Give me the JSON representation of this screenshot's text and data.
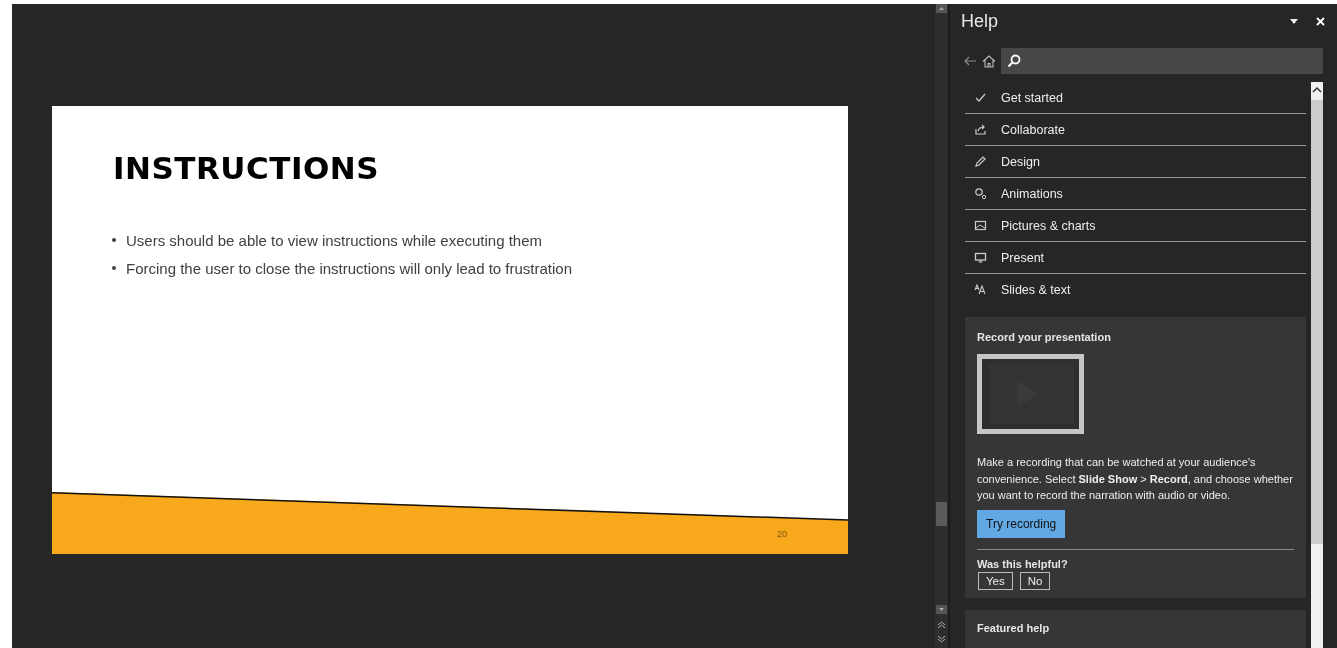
{
  "slide": {
    "title": "INSTRUCTIONS",
    "bullets": [
      "Users should be able to view instructions while executing them",
      "Forcing the user to close the instructions will only lead to frustration"
    ],
    "page_number": "20"
  },
  "help": {
    "title": "Help",
    "topics": [
      {
        "label": "Get started"
      },
      {
        "label": "Collaborate"
      },
      {
        "label": "Design"
      },
      {
        "label": "Animations"
      },
      {
        "label": "Pictures & charts"
      },
      {
        "label": "Present"
      },
      {
        "label": "Slides & text"
      }
    ],
    "card": {
      "title": "Record your presentation",
      "body": "Make a recording that can be watched at your audience's convenience. Select **Slide Show** > **Record**, and choose whether you want to record the narration with audio or video.",
      "button": "Try recording",
      "question": "Was this helpful?",
      "answers": [
        "Yes",
        "No"
      ]
    },
    "featured": {
      "title": "Featured help"
    }
  }
}
